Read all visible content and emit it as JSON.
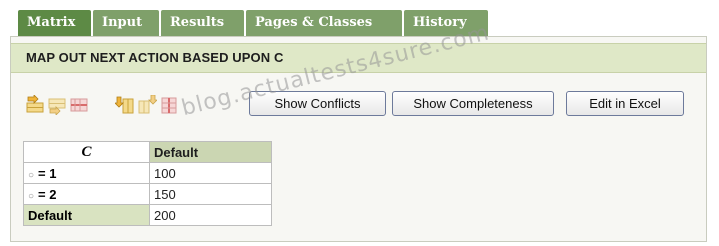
{
  "tabs": [
    {
      "label": "Matrix"
    },
    {
      "label": "Input"
    },
    {
      "label": "Results"
    },
    {
      "label": "Pages & Classes"
    },
    {
      "label": "History"
    }
  ],
  "active_tab": "Matrix",
  "header": {
    "title": "MAP OUT NEXT ACTION BASED UPON C"
  },
  "toolbar": {
    "icons": [
      "insert-row-before-icon",
      "insert-row-after-icon",
      "delete-row-icon",
      "insert-column-before-icon",
      "insert-column-after-icon",
      "delete-column-icon"
    ],
    "buttons": {
      "show_conflicts": "Show Conflicts",
      "show_completeness": "Show Completeness",
      "edit_in_excel": "Edit in Excel"
    }
  },
  "matrix": {
    "column_header": "C",
    "default_header": "Default",
    "rows": [
      {
        "condition": "= 1",
        "value": "100"
      },
      {
        "condition": "= 2",
        "value": "150"
      },
      {
        "condition": "Default",
        "value": "200"
      }
    ]
  },
  "watermark": "blog.actualtests4sure.com",
  "colors": {
    "tab": "#7fa06a",
    "tab_active": "#5d8a45",
    "header_bar": "#dfe8c7",
    "table_header": "#cbd6b2"
  }
}
